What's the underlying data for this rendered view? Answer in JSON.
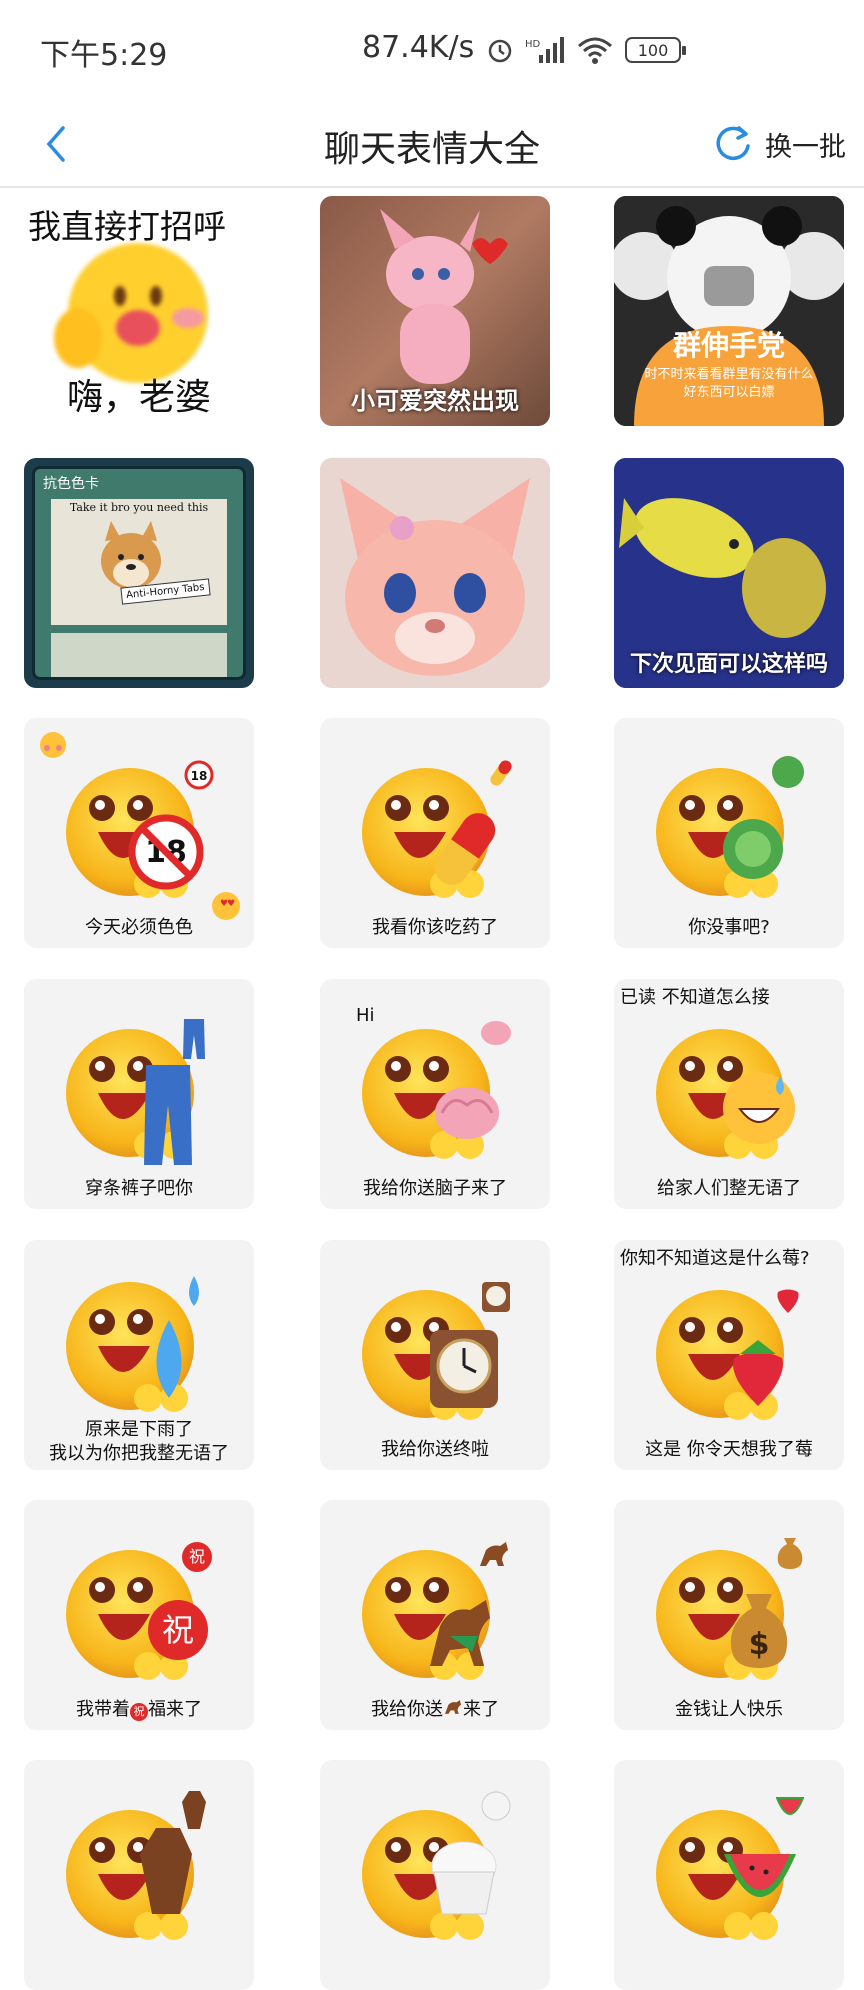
{
  "status_bar": {
    "time": "下午5:29",
    "network_speed": "87.4K/s",
    "battery": "100"
  },
  "nav": {
    "title": "聊天表情大全",
    "refresh_label": "换一批"
  },
  "stickers": {
    "s1": {
      "top_text": "我直接打招呼",
      "caption": "嗨，老婆"
    },
    "s2": {
      "caption": "小可爱突然出现"
    },
    "s3": {
      "headline": "群伸手党",
      "caption": "时不时来看看群里有没有什么好东西可以白嫖"
    },
    "s4": {
      "card_title": "抗色色卡",
      "card_quote": "Take it bro you need this",
      "card_tag": "Anti-Horny Tabs"
    },
    "s5": {
      "caption": ""
    },
    "s6": {
      "caption": "下次见面可以这样吗"
    },
    "s7": {
      "caption": "今天必须色色",
      "icon": "no-18-icon"
    },
    "s8": {
      "caption": "我看你该吃药了",
      "icon": "pill-icon"
    },
    "s9": {
      "caption": "你没事吧?",
      "icon": "cabbage-icon"
    },
    "s10": {
      "caption": "穿条裤子吧你",
      "icon": "jeans-icon"
    },
    "s11": {
      "caption": "我给你送脑子来了",
      "top_text": "Hi",
      "icon": "brain-icon"
    },
    "s12": {
      "top_text": "已读 不知道怎么接",
      "caption": "给家人们整无语了",
      "icon": "sweat-smile-icon"
    },
    "s13": {
      "caption_line1": "原来是下雨了",
      "caption_line2": "我以为你把我整无语了",
      "icon": "water-drop-icon"
    },
    "s14": {
      "caption": "我给你送终啦",
      "icon": "clock-icon"
    },
    "s15": {
      "top_text": "你知不知道这是什么莓?",
      "caption": "这是 你令天想我了莓",
      "icon": "strawberry-icon"
    },
    "s16": {
      "caption_pre": "我带着",
      "caption_mid": "祝",
      "caption_post": "福来了",
      "icon_text": "祝"
    },
    "s17": {
      "caption_pre": "我给你送",
      "caption_post": "来了",
      "icon": "horse-icon"
    },
    "s18": {
      "caption": "金钱让人快乐",
      "icon": "money-bag-icon"
    },
    "s19": {
      "icon": "coffin-icon"
    },
    "s20": {
      "icon": "rice-icon"
    },
    "s21": {
      "icon": "watermelon-icon"
    }
  }
}
